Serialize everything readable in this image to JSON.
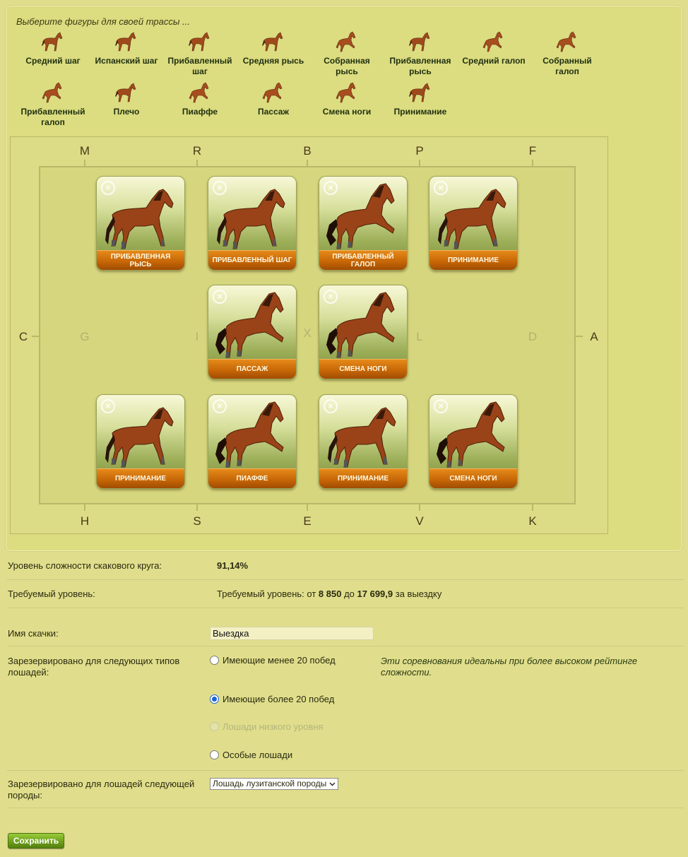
{
  "intro": "Выберите фигуры для своей трассы ...",
  "palette": [
    {
      "label": "Средний шаг"
    },
    {
      "label": "Испанский шаг"
    },
    {
      "label": "Прибавленный шаг"
    },
    {
      "label": "Средняя рысь"
    },
    {
      "label": "Собранная рысь"
    },
    {
      "label": "Прибавленная рысь"
    },
    {
      "label": "Средний галоп"
    },
    {
      "label": "Собранный галоп"
    },
    {
      "label": "Прибавленный галоп"
    },
    {
      "label": "Плечо"
    },
    {
      "label": "Пиаффе"
    },
    {
      "label": "Пассаж"
    },
    {
      "label": "Смена ноги"
    },
    {
      "label": "Принимание"
    }
  ],
  "arena": {
    "top_letters": [
      "M",
      "R",
      "B",
      "P",
      "F"
    ],
    "bottom_letters": [
      "H",
      "S",
      "E",
      "V",
      "K"
    ],
    "left_letter": "C",
    "right_letter": "A",
    "center_letters": [
      "G",
      "I",
      "X",
      "L",
      "D"
    ]
  },
  "cards": [
    {
      "caption": "Прибавленная рысь",
      "close": "×"
    },
    {
      "caption": "Прибавленный шаг",
      "close": "×"
    },
    {
      "caption": "Прибавленный галоп",
      "close": "×"
    },
    {
      "caption": "Принимание",
      "close": "×"
    },
    {
      "caption": "Пассаж",
      "close": "×"
    },
    {
      "caption": "Смена ноги",
      "close": "×"
    },
    {
      "caption": "Принимание",
      "close": "×"
    },
    {
      "caption": "Пиаффе",
      "close": "×"
    },
    {
      "caption": "Принимание",
      "close": "×"
    },
    {
      "caption": "Смена ноги",
      "close": "×"
    }
  ],
  "difficulty": {
    "label": "Уровень сложности скакового круга:",
    "value": "91,14%"
  },
  "required": {
    "label": "Требуемый уровень:",
    "prefix": "Требуемый уровень: от ",
    "from": "8 850",
    "middle": " до ",
    "to": "17 699,9",
    "suffix": " за выездку"
  },
  "race_name": {
    "label": "Имя скачки:",
    "value": "Выездка"
  },
  "reserved_types": {
    "label": "Зарезервировано для следующих типов лошадей:",
    "options": [
      {
        "label": "Имеющие менее 20 побед",
        "selected": false,
        "disabled": false
      },
      {
        "label": "Имеющие более 20 побед",
        "selected": true,
        "disabled": false
      },
      {
        "label": "Лошади низкого уровня",
        "selected": false,
        "disabled": true
      },
      {
        "label": "Особые лошади",
        "selected": false,
        "disabled": false
      }
    ],
    "note": "Эти соревнования идеальны при более высоком рейтинге сложности."
  },
  "reserved_breed": {
    "label": "Зарезервировано для лошадей следующей породы:",
    "value": "Лошадь лузитанской породы"
  },
  "save_label": "Сохранить",
  "icons": {
    "horse": "horse-icon",
    "close": "close-icon",
    "dropdown": "chevron-down-icon"
  },
  "colors": {
    "background": "#e0de8c",
    "caption": "#c46406",
    "save": "#6fa01c",
    "radio": "#1a64d8"
  }
}
